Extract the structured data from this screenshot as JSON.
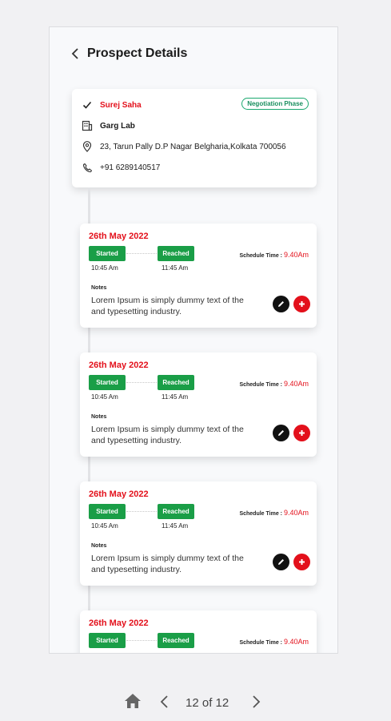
{
  "header": {
    "title": "Prospect Details"
  },
  "prospect": {
    "name": "Surej Saha",
    "phase": "Negotiation Phase",
    "company": "Garg Lab",
    "address": "23, Tarun Pally D.P Nagar Belgharia,Kolkata 700056",
    "phone": "+91 6289140517"
  },
  "visits": [
    {
      "date": "26th May 2022",
      "started_label": "Started",
      "reached_label": "Reached",
      "started_time": "10:45 Am",
      "reached_time": "11:45 Am",
      "schedule_label": "Schedule Time :",
      "schedule_time": "9.40Am",
      "notes_label": "Notes",
      "notes": "Lorem Ipsum is simply dummy text of the and typesetting industry."
    },
    {
      "date": "26th May 2022",
      "started_label": "Started",
      "reached_label": "Reached",
      "started_time": "10:45 Am",
      "reached_time": "11:45 Am",
      "schedule_label": "Schedule Time :",
      "schedule_time": "9.40Am",
      "notes_label": "Notes",
      "notes": "Lorem Ipsum is simply dummy text of the and typesetting industry."
    },
    {
      "date": "26th May 2022",
      "started_label": "Started",
      "reached_label": "Reached",
      "started_time": "10:45 Am",
      "reached_time": "11:45 Am",
      "schedule_label": "Schedule Time :",
      "schedule_time": "9.40Am",
      "notes_label": "Notes",
      "notes": "Lorem Ipsum is simply dummy text of the and typesetting industry."
    },
    {
      "date": "26th May 2022",
      "started_label": "Started",
      "reached_label": "Reached",
      "schedule_label": "Schedule Time :",
      "schedule_time": "9.40Am"
    }
  ],
  "footer": {
    "page_indicator": "12 of 12"
  },
  "colors": {
    "accent_red": "#e3101b",
    "green": "#1a9e47",
    "badge_green": "#1ba86f"
  }
}
